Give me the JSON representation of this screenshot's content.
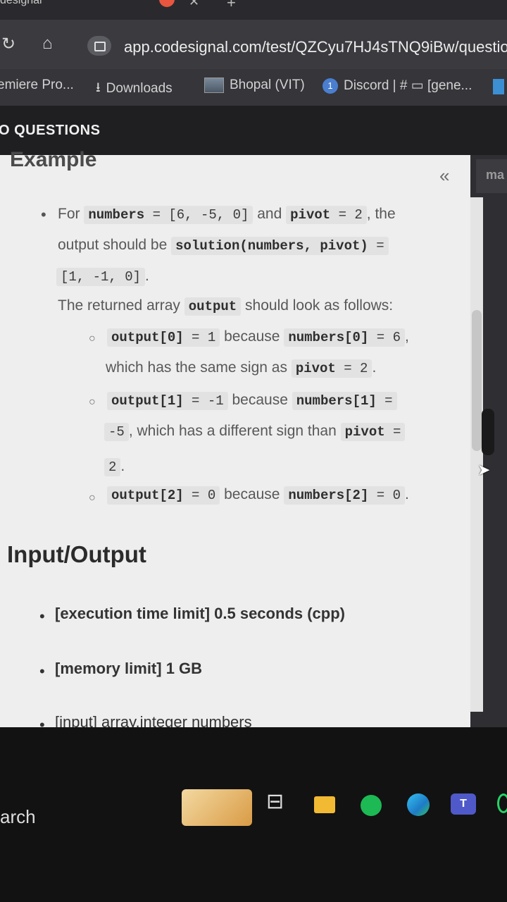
{
  "browser": {
    "tab_title": "desigrial",
    "url": "app.codesignal.com/test/QZCyu7HJ4sTNQ9iBw/questio",
    "bookmarks": [
      "emiere Pro...",
      "Downloads",
      "Bhopal (VIT)",
      "Discord | # ▭ [gene..."
    ]
  },
  "header": {
    "questions_label": "O QUESTIONS",
    "right_tab": "ma"
  },
  "example": {
    "title": "Example",
    "line1_for": "For",
    "line1_numbers": "numbers",
    "line1_eq1": "= [6, -5, 0]",
    "line1_and": "and",
    "line1_pivot": "pivot",
    "line1_eq2": "= 2",
    "line1_the": ", the",
    "line2_text": "output should be",
    "line2_code": "solution(numbers, pivot)",
    "line2_eq": "=",
    "line3_code": "[1, -1, 0]",
    "line3_dot": ".",
    "returned_text": "The returned array",
    "returned_code": "output",
    "returned_tail": "should look as follows:",
    "s1_code": "output[0]",
    "s1_eq": "= 1",
    "s1_because": "because",
    "s1_code2": "numbers[0]",
    "s1_eq2": "= 6",
    "s1_comma": ",",
    "s1b_text": "which has the same sign as",
    "s1b_code": "pivot",
    "s1b_eq": "= 2",
    "s1b_dot": ".",
    "s2_code": "output[1]",
    "s2_eq": "= -1",
    "s2_because": "because",
    "s2_code2": "numbers[1]",
    "s2_eq2": "=",
    "s2b_code": "-5",
    "s2b_text": ", which has a different sign than",
    "s2b_code2": "pivot",
    "s2b_eq": "=",
    "s2c_code": "2",
    "s2c_dot": ".",
    "s3_code": "output[2]",
    "s3_eq": "= 0",
    "s3_because": "because",
    "s3_code2": "numbers[2]",
    "s3_eq2": "= 0",
    "s3_dot": "."
  },
  "io": {
    "title": "Input/Output",
    "items": [
      "[execution time limit] 0.5 seconds (cpp)",
      "[memory limit] 1 GB",
      "[input] array.integer numbers"
    ]
  },
  "taskbar": {
    "search_text": "arch",
    "teams_label": "T"
  }
}
